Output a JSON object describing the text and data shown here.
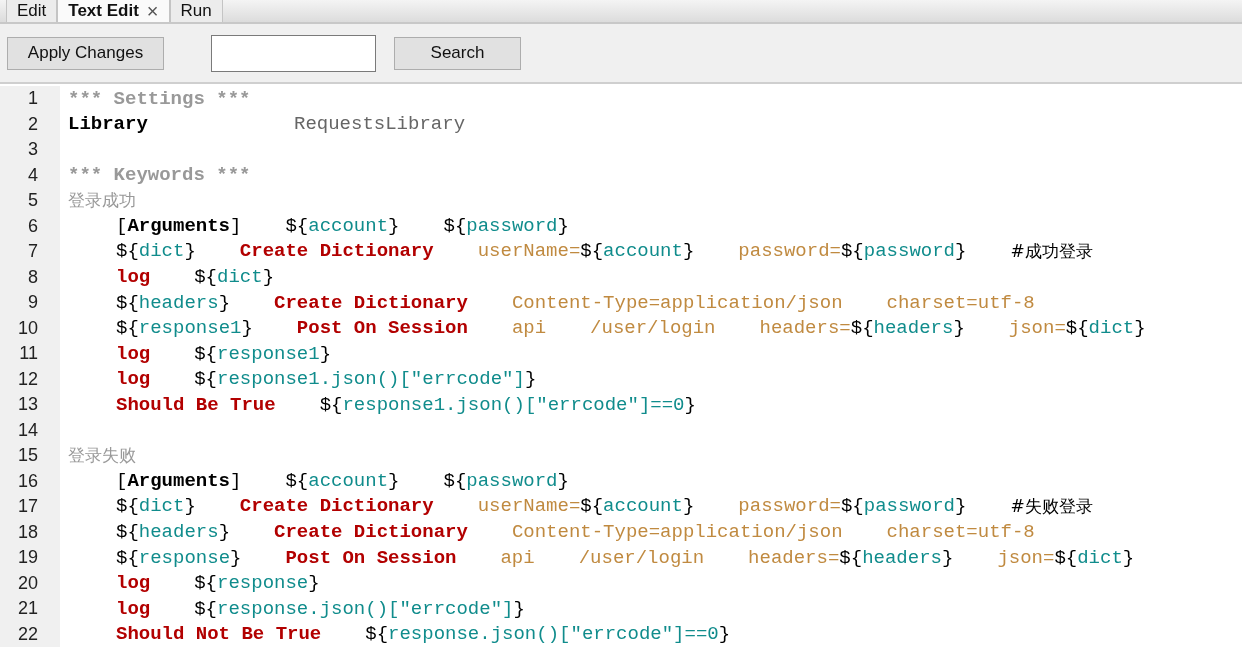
{
  "tabs": [
    {
      "label": "Edit",
      "selected": false
    },
    {
      "label": "Text Edit",
      "selected": true,
      "close_label": "×"
    },
    {
      "label": "Run",
      "selected": false
    }
  ],
  "toolbar": {
    "apply_button": "Apply Changes",
    "search_button": "Search"
  },
  "lines": [
    {
      "number": "1",
      "kind": "heading",
      "cells": [
        [
          {
            "kind": "section",
            "text": "*** Settings ***"
          }
        ]
      ]
    },
    {
      "number": "2",
      "kind": "setting",
      "cells": [
        [
          {
            "kind": "name",
            "text": "Library"
          }
        ],
        [
          {
            "kind": "value",
            "text": "RequestsLibrary"
          }
        ]
      ]
    },
    {
      "number": "3",
      "kind": "blank"
    },
    {
      "number": "4",
      "kind": "heading",
      "cells": [
        [
          {
            "kind": "section",
            "text": "*** Keywords ***"
          }
        ]
      ]
    },
    {
      "number": "5",
      "kind": "testcase",
      "cells": [
        [
          {
            "kind": "testcase",
            "text": "登录成功"
          }
        ]
      ]
    },
    {
      "number": "6",
      "kind": "step",
      "cells": [
        [
          {
            "kind": "punct",
            "text": "["
          },
          {
            "kind": "name",
            "text": "Arguments"
          },
          {
            "kind": "punct",
            "text": "]"
          }
        ],
        [
          {
            "kind": "sigil",
            "text": "${"
          },
          {
            "kind": "variable",
            "text": "account"
          },
          {
            "kind": "sigil",
            "text": "}"
          }
        ],
        [
          {
            "kind": "sigil",
            "text": "${"
          },
          {
            "kind": "variable",
            "text": "password"
          },
          {
            "kind": "sigil",
            "text": "}"
          }
        ]
      ]
    },
    {
      "number": "7",
      "kind": "step",
      "cells": [
        [
          {
            "kind": "sigil",
            "text": "${"
          },
          {
            "kind": "variable",
            "text": "dict"
          },
          {
            "kind": "sigil",
            "text": "}"
          }
        ],
        [
          {
            "kind": "keyword",
            "text": "Create Dictionary"
          }
        ],
        [
          {
            "kind": "argument",
            "text": "userName="
          },
          {
            "kind": "sigil",
            "text": "${"
          },
          {
            "kind": "variable",
            "text": "account"
          },
          {
            "kind": "sigil",
            "text": "}"
          }
        ],
        [
          {
            "kind": "argument",
            "text": "password="
          },
          {
            "kind": "sigil",
            "text": "${"
          },
          {
            "kind": "variable",
            "text": "password"
          },
          {
            "kind": "sigil",
            "text": "}"
          }
        ],
        [
          {
            "kind": "comment",
            "text": "#成功登录"
          }
        ]
      ]
    },
    {
      "number": "8",
      "kind": "step",
      "cells": [
        [
          {
            "kind": "keyword",
            "text": "log"
          }
        ],
        [
          {
            "kind": "sigil",
            "text": "${"
          },
          {
            "kind": "variable",
            "text": "dict"
          },
          {
            "kind": "sigil",
            "text": "}"
          }
        ]
      ]
    },
    {
      "number": "9",
      "kind": "step",
      "cells": [
        [
          {
            "kind": "sigil",
            "text": "${"
          },
          {
            "kind": "variable",
            "text": "headers"
          },
          {
            "kind": "sigil",
            "text": "}"
          }
        ],
        [
          {
            "kind": "keyword",
            "text": "Create Dictionary"
          }
        ],
        [
          {
            "kind": "argument",
            "text": "Content-Type=application/json"
          }
        ],
        [
          {
            "kind": "argument",
            "text": "charset=utf-8"
          }
        ]
      ]
    },
    {
      "number": "10",
      "kind": "step",
      "cells": [
        [
          {
            "kind": "sigil",
            "text": "${"
          },
          {
            "kind": "variable",
            "text": "response1"
          },
          {
            "kind": "sigil",
            "text": "}"
          }
        ],
        [
          {
            "kind": "keyword",
            "text": "Post On Session"
          }
        ],
        [
          {
            "kind": "argument",
            "text": "api"
          }
        ],
        [
          {
            "kind": "argument",
            "text": "/user/login"
          }
        ],
        [
          {
            "kind": "argument",
            "text": "headers="
          },
          {
            "kind": "sigil",
            "text": "${"
          },
          {
            "kind": "variable",
            "text": "headers"
          },
          {
            "kind": "sigil",
            "text": "}"
          }
        ],
        [
          {
            "kind": "argument",
            "text": "json="
          },
          {
            "kind": "sigil",
            "text": "${"
          },
          {
            "kind": "variable",
            "text": "dict"
          },
          {
            "kind": "sigil",
            "text": "}"
          }
        ]
      ]
    },
    {
      "number": "11",
      "kind": "step",
      "cells": [
        [
          {
            "kind": "keyword",
            "text": "log"
          }
        ],
        [
          {
            "kind": "sigil",
            "text": "${"
          },
          {
            "kind": "variable",
            "text": "response1"
          },
          {
            "kind": "sigil",
            "text": "}"
          }
        ]
      ]
    },
    {
      "number": "12",
      "kind": "step",
      "cells": [
        [
          {
            "kind": "keyword",
            "text": "log"
          }
        ],
        [
          {
            "kind": "sigil",
            "text": "${"
          },
          {
            "kind": "variable",
            "text": "response1.json()[\"errcode\"]"
          },
          {
            "kind": "sigil",
            "text": "}"
          }
        ]
      ]
    },
    {
      "number": "13",
      "kind": "step",
      "cells": [
        [
          {
            "kind": "keyword",
            "text": "Should Be True"
          }
        ],
        [
          {
            "kind": "sigil",
            "text": "${"
          },
          {
            "kind": "variable",
            "text": "response1.json()[\"errcode\"]==0"
          },
          {
            "kind": "sigil",
            "text": "}"
          }
        ]
      ]
    },
    {
      "number": "14",
      "kind": "blank"
    },
    {
      "number": "15",
      "kind": "testcase",
      "cells": [
        [
          {
            "kind": "testcase",
            "text": "登录失败"
          }
        ]
      ]
    },
    {
      "number": "16",
      "kind": "step",
      "cells": [
        [
          {
            "kind": "punct",
            "text": "["
          },
          {
            "kind": "name",
            "text": "Arguments"
          },
          {
            "kind": "punct",
            "text": "]"
          }
        ],
        [
          {
            "kind": "sigil",
            "text": "${"
          },
          {
            "kind": "variable",
            "text": "account"
          },
          {
            "kind": "sigil",
            "text": "}"
          }
        ],
        [
          {
            "kind": "sigil",
            "text": "${"
          },
          {
            "kind": "variable",
            "text": "password"
          },
          {
            "kind": "sigil",
            "text": "}"
          }
        ]
      ]
    },
    {
      "number": "17",
      "kind": "step",
      "cells": [
        [
          {
            "kind": "sigil",
            "text": "${"
          },
          {
            "kind": "variable",
            "text": "dict"
          },
          {
            "kind": "sigil",
            "text": "}"
          }
        ],
        [
          {
            "kind": "keyword",
            "text": "Create Dictionary"
          }
        ],
        [
          {
            "kind": "argument",
            "text": "userName="
          },
          {
            "kind": "sigil",
            "text": "${"
          },
          {
            "kind": "variable",
            "text": "account"
          },
          {
            "kind": "sigil",
            "text": "}"
          }
        ],
        [
          {
            "kind": "argument",
            "text": "password="
          },
          {
            "kind": "sigil",
            "text": "${"
          },
          {
            "kind": "variable",
            "text": "password"
          },
          {
            "kind": "sigil",
            "text": "}"
          }
        ],
        [
          {
            "kind": "comment",
            "text": "#失败登录"
          }
        ]
      ]
    },
    {
      "number": "18",
      "kind": "step",
      "cells": [
        [
          {
            "kind": "sigil",
            "text": "${"
          },
          {
            "kind": "variable",
            "text": "headers"
          },
          {
            "kind": "sigil",
            "text": "}"
          }
        ],
        [
          {
            "kind": "keyword",
            "text": "Create Dictionary"
          }
        ],
        [
          {
            "kind": "argument",
            "text": "Content-Type=application/json"
          }
        ],
        [
          {
            "kind": "argument",
            "text": "charset=utf-8"
          }
        ]
      ]
    },
    {
      "number": "19",
      "kind": "step",
      "cells": [
        [
          {
            "kind": "sigil",
            "text": "${"
          },
          {
            "kind": "variable",
            "text": "response"
          },
          {
            "kind": "sigil",
            "text": "}"
          }
        ],
        [
          {
            "kind": "keyword",
            "text": "Post On Session"
          }
        ],
        [
          {
            "kind": "argument",
            "text": "api"
          }
        ],
        [
          {
            "kind": "argument",
            "text": "/user/login"
          }
        ],
        [
          {
            "kind": "argument",
            "text": "headers="
          },
          {
            "kind": "sigil",
            "text": "${"
          },
          {
            "kind": "variable",
            "text": "headers"
          },
          {
            "kind": "sigil",
            "text": "}"
          }
        ],
        [
          {
            "kind": "argument",
            "text": "json="
          },
          {
            "kind": "sigil",
            "text": "${"
          },
          {
            "kind": "variable",
            "text": "dict"
          },
          {
            "kind": "sigil",
            "text": "}"
          }
        ]
      ]
    },
    {
      "number": "20",
      "kind": "step",
      "cells": [
        [
          {
            "kind": "keyword",
            "text": "log"
          }
        ],
        [
          {
            "kind": "sigil",
            "text": "${"
          },
          {
            "kind": "variable",
            "text": "response"
          },
          {
            "kind": "sigil",
            "text": "}"
          }
        ]
      ]
    },
    {
      "number": "21",
      "kind": "step",
      "cells": [
        [
          {
            "kind": "keyword",
            "text": "log"
          }
        ],
        [
          {
            "kind": "sigil",
            "text": "${"
          },
          {
            "kind": "variable",
            "text": "response.json()[\"errcode\"]"
          },
          {
            "kind": "sigil",
            "text": "}"
          }
        ]
      ]
    },
    {
      "number": "22",
      "kind": "step",
      "cells": [
        [
          {
            "kind": "keyword",
            "text": "Should Not Be True"
          }
        ],
        [
          {
            "kind": "sigil",
            "text": "${"
          },
          {
            "kind": "variable",
            "text": "response.json()[\"errcode\"]==0"
          },
          {
            "kind": "sigil",
            "text": "}"
          }
        ]
      ]
    }
  ]
}
